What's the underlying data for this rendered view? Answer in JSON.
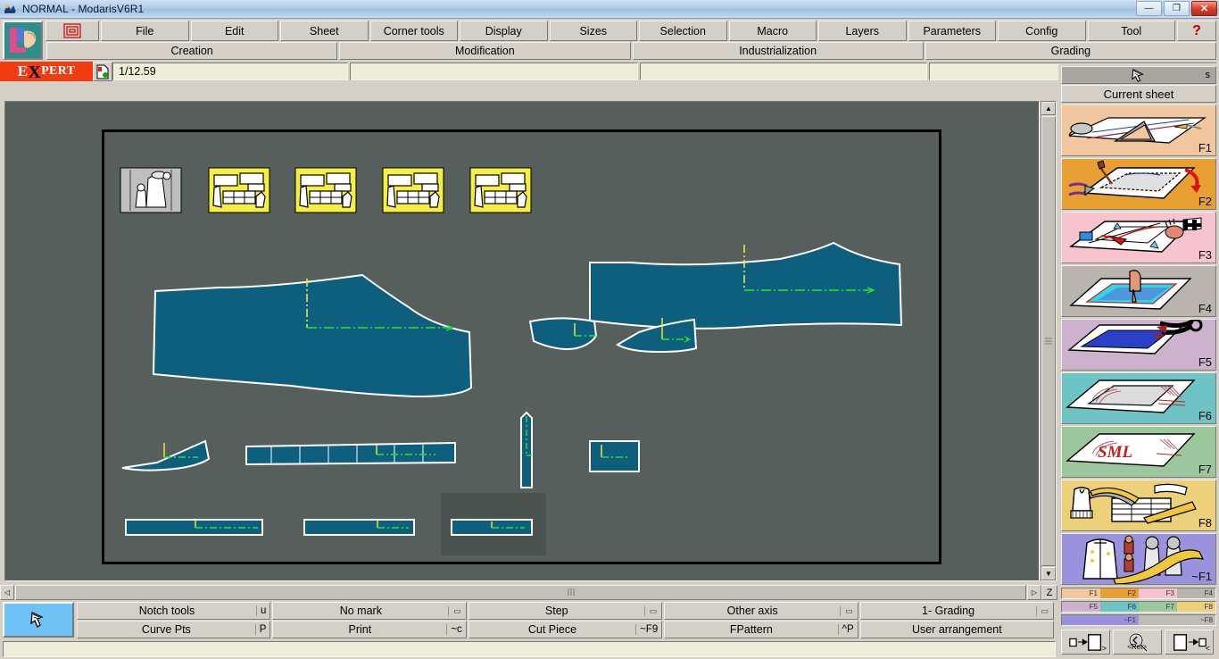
{
  "window": {
    "title": "NORMAL - ModarisV6R1",
    "icon": "app-icon",
    "buttons": {
      "minimize": "—",
      "maximize": "❐",
      "close": "✕"
    }
  },
  "menu": {
    "logo_icon": "modaris-logo-icon",
    "pattern_icon": "pattern-icon",
    "items": [
      {
        "label": "File"
      },
      {
        "label": "Edit"
      },
      {
        "label": "Sheet"
      },
      {
        "label": "Corner tools"
      },
      {
        "label": "Display"
      },
      {
        "label": "Sizes"
      },
      {
        "label": "Selection"
      },
      {
        "label": "Macro"
      },
      {
        "label": "Layers"
      },
      {
        "label": "Parameters"
      },
      {
        "label": "Config"
      },
      {
        "label": "Tool"
      }
    ],
    "help_label": "?"
  },
  "modes": [
    {
      "label": "Creation"
    },
    {
      "label": "Modification"
    },
    {
      "label": "Industrialization"
    },
    {
      "label": "Grading"
    }
  ],
  "info": {
    "expert_prefix": "E",
    "expert_x": "X",
    "expert_suffix": "PERT",
    "scale_icon": "page-status-icon",
    "scale_value": "1/12.59"
  },
  "sidebar": {
    "top_icon": "hand-pointer-icon",
    "top_right_label": "s",
    "current_sheet_label": "Current sheet",
    "panels": [
      {
        "key": "F1",
        "name": "drafting-panel",
        "bg": "#f2c7a0"
      },
      {
        "key": "F2",
        "name": "modify-panel",
        "bg": "#e8a033"
      },
      {
        "key": "F3",
        "name": "corner-tools-panel",
        "bg": "#f7c3ce"
      },
      {
        "key": "F4",
        "name": "selection-panel",
        "bg": "#b9b5ae"
      },
      {
        "key": "F5",
        "name": "cut-panel",
        "bg": "#cdb2cd"
      },
      {
        "key": "F6",
        "name": "grading-panel",
        "bg": "#6ec4c4"
      },
      {
        "key": "F7",
        "name": "sizes-panel",
        "bg": "#9cc79c"
      },
      {
        "key": "F8",
        "name": "industrialization-panel",
        "bg": "#ecd07a"
      },
      {
        "key": "~F1",
        "name": "garment-panel",
        "bg": "#9a92dd"
      }
    ],
    "legend_rows": [
      [
        {
          "label": "F1",
          "color": "#f2c7a0"
        },
        {
          "label": "F2",
          "color": "#e8a033"
        },
        {
          "label": "F3",
          "color": "#f7c3ce"
        },
        {
          "label": "F4",
          "color": "#b9b5ae"
        }
      ],
      [
        {
          "label": "F5",
          "color": "#cdb2cd"
        },
        {
          "label": "F6",
          "color": "#6ec4c4"
        },
        {
          "label": "F7",
          "color": "#9cc79c"
        },
        {
          "label": "F8",
          "color": "#ecd07a"
        }
      ],
      [
        {
          "label": "~F1",
          "color": "#9a92dd"
        },
        {
          "label": "~F8",
          "color": "#c0bcb4"
        }
      ]
    ],
    "zoom_buttons": [
      {
        "name": "zoom-out-button",
        "corner": ">",
        "mid": ""
      },
      {
        "name": "zoom-reset-button",
        "corner": "",
        "mid": "<Ret>"
      },
      {
        "name": "zoom-in-button",
        "corner": "<",
        "mid": ""
      }
    ]
  },
  "commands": {
    "cursor_icon": "hand-pointer-icon",
    "row1": [
      {
        "label": "Notch tools",
        "key": "u",
        "dropdown": false
      },
      {
        "label": "No mark",
        "key": "",
        "dropdown": true
      },
      {
        "label": "Step",
        "key": "",
        "dropdown": true
      },
      {
        "label": "Other axis",
        "key": "",
        "dropdown": true
      },
      {
        "label": "1- Grading",
        "key": "",
        "dropdown": true
      }
    ],
    "row2": [
      {
        "label": "Curve Pts",
        "key": "P",
        "dropdown": false
      },
      {
        "label": "Print",
        "key": "~c",
        "dropdown": false
      },
      {
        "label": "Cut Piece",
        "key": "~F9",
        "dropdown": false
      },
      {
        "label": "FPattern",
        "key": "^P",
        "dropdown": false
      },
      {
        "label": "User arrangement",
        "key": "",
        "dropdown": false
      }
    ],
    "message": ""
  },
  "scrollbars": {
    "v_up": "▲",
    "v_down": "▼",
    "h_left": "◁",
    "h_right": "▷",
    "h_zoom_label": "Z"
  },
  "canvas": {
    "background": "#565f5c",
    "piece_fill": "#0d5f7d",
    "piece_stroke": "#ffffff",
    "grainline_green": "#2ee02e",
    "grainline_yellow": "#e8e838",
    "thumb_yellow": "#f5ee45",
    "thumb_gray": "#bfbfbf",
    "highlight": "#4a5350"
  }
}
